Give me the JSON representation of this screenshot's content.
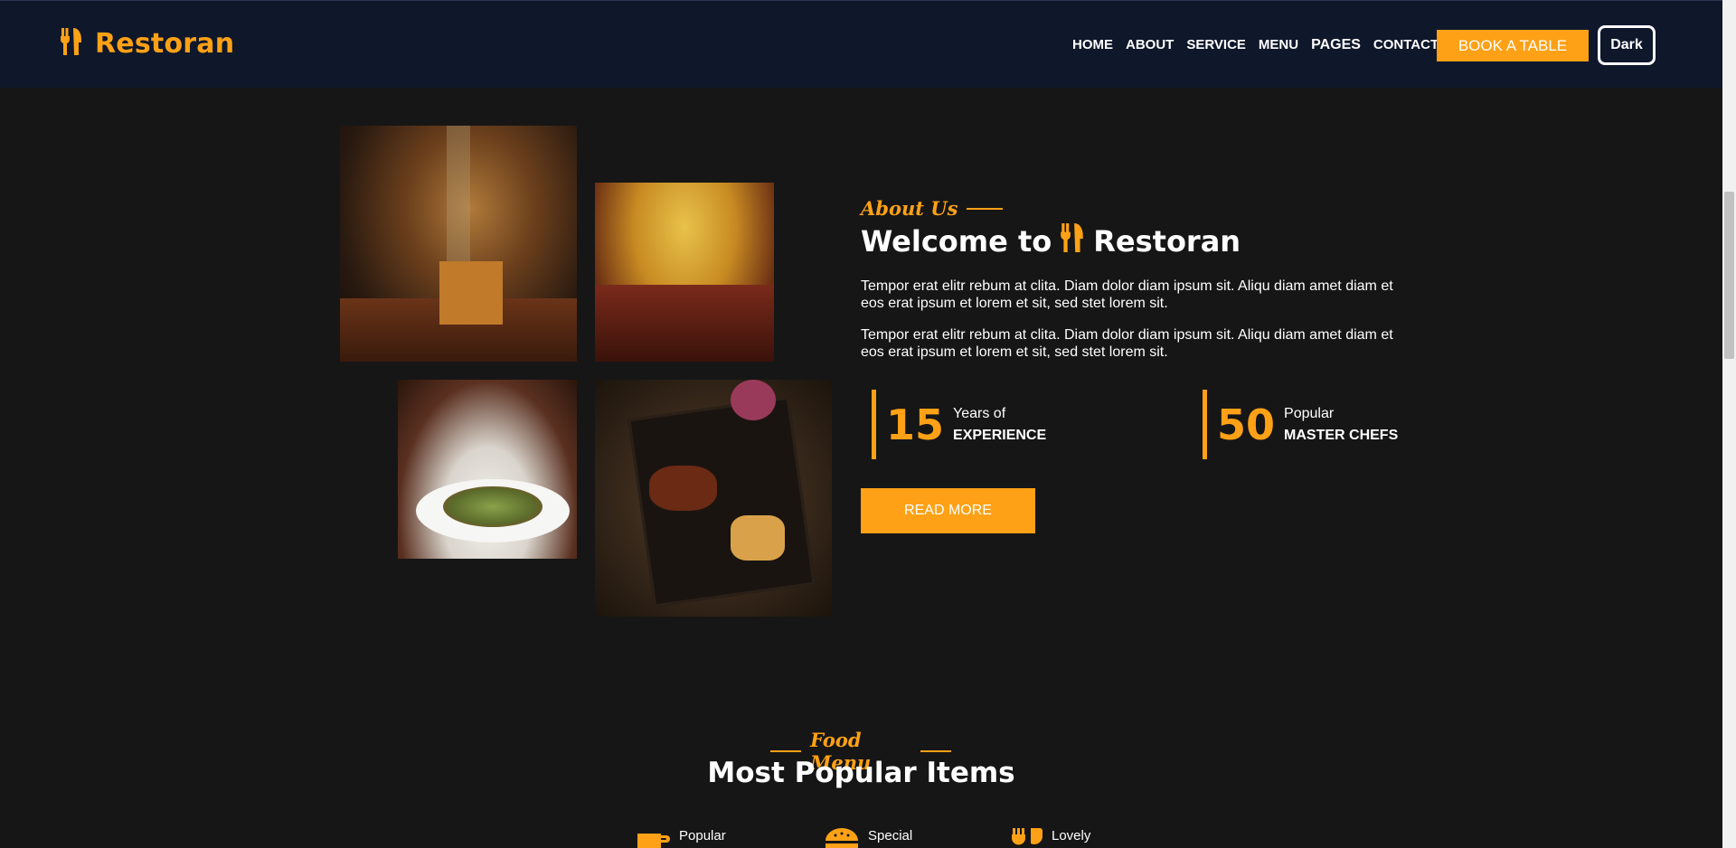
{
  "brand": {
    "name": "Restoran",
    "icon": "utensils-icon"
  },
  "nav": {
    "links": [
      "HOME",
      "ABOUT",
      "SERVICE",
      "MENU",
      "PAGES",
      "CONTACT"
    ],
    "book_label": "BOOK A TABLE",
    "theme_label": "Dark"
  },
  "about": {
    "subtitle": "About Us",
    "title_prefix": "Welcome to",
    "title_brand": "Restoran",
    "paragraphs": [
      "Tempor erat elitr rebum at clita. Diam dolor diam ipsum sit. Aliqu diam amet diam et eos erat ipsum et lorem et sit, sed stet lorem sit.",
      "Tempor erat elitr rebum at clita. Diam dolor diam ipsum sit. Aliqu diam amet diam et eos erat ipsum et lorem et sit, sed stet lorem sit."
    ],
    "stats": [
      {
        "number": "15",
        "line1": "Years of",
        "line2": "EXPERIENCE"
      },
      {
        "number": "50",
        "line1": "Popular",
        "line2": "MASTER CHEFS"
      }
    ],
    "read_more_label": "READ MORE"
  },
  "menu": {
    "subtitle": "Food Menu",
    "title": "Most Popular Items",
    "tabs": [
      {
        "label": "Popular",
        "icon": "coffee-icon"
      },
      {
        "label": "Special",
        "icon": "hamburger-icon"
      },
      {
        "label": "Lovely",
        "icon": "utensils-icon"
      }
    ]
  },
  "colors": {
    "accent": "#fea116",
    "navbar": "#0f172b",
    "background": "#161616"
  }
}
